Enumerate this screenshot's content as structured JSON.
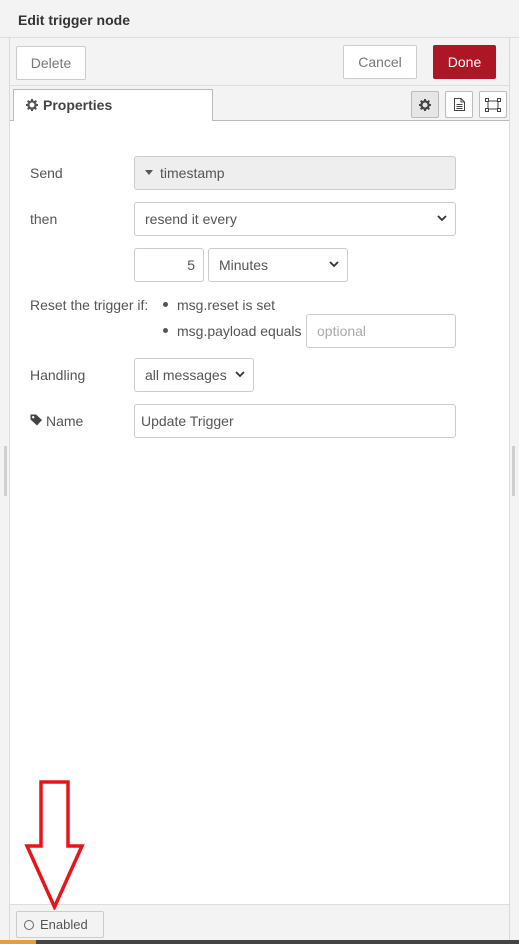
{
  "dialog": {
    "title": "Edit trigger node"
  },
  "buttons": {
    "delete": "Delete",
    "cancel": "Cancel",
    "done": "Done"
  },
  "tabs": {
    "properties": "Properties",
    "icons": [
      "settings-icon",
      "description-icon",
      "appearance-icon"
    ]
  },
  "form": {
    "send": {
      "label": "Send",
      "value": "timestamp"
    },
    "then": {
      "label": "then",
      "value": "resend it every"
    },
    "interval": {
      "amount": "5",
      "units": "Minutes"
    },
    "reset": {
      "label": "Reset the trigger if:",
      "condition1": "msg.reset is set",
      "condition2": "msg.payload equals",
      "placeholder": "optional"
    },
    "handling": {
      "label": "Handling",
      "value": "all messages"
    },
    "name": {
      "label": "Name",
      "value": "Update Trigger"
    }
  },
  "footer": {
    "enabled_label": "Enabled"
  },
  "colors": {
    "done_button": "#ad1625",
    "annotation_arrow": "#e8141b"
  }
}
